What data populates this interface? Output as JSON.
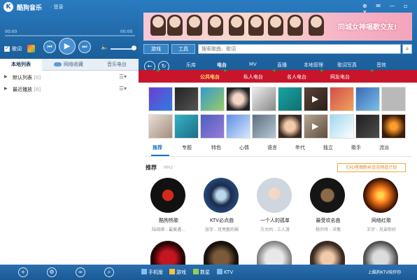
{
  "app": {
    "logo": "K",
    "name": "酷狗音乐",
    "login": "· 登录"
  },
  "player": {
    "time_current": "00:00",
    "time_total": "00:00",
    "lyric_label": "歌词",
    "prev_icon": "prev-icon",
    "play_icon": "play-icon",
    "next_icon": "next-icon",
    "volume_icon": "volume-icon"
  },
  "left_tabs": [
    "本地列表",
    "网络收藏",
    "音乐电台"
  ],
  "left_list": [
    {
      "label": "默认列表",
      "count": "[0]"
    },
    {
      "label": "最近播放",
      "count": "[0]"
    }
  ],
  "left_bottom": [
    "add-icon",
    "settings-icon",
    "loop-icon",
    "search-icon"
  ],
  "window": {
    "controls": "⊕ ✉ — ▫ ✕"
  },
  "banner": {
    "text": "同城女神唱歌交友!"
  },
  "toolbar": {
    "game_label": "游戏",
    "tool_label": "工具",
    "search_placeholder": "搜索歌曲、歌词"
  },
  "main_tabs": [
    "乐库",
    "电台",
    "MV",
    "直播",
    "本地管理",
    "歌词写真",
    "音效"
  ],
  "active_main_tab": "电台",
  "sub_tabs": [
    "公共电台",
    "私人电台",
    "名人电台",
    "网友电台"
  ],
  "category_tabs": [
    "推荐",
    "专题",
    "特色",
    "心情",
    "语言",
    "年代",
    "独立",
    "歌手",
    "流派"
  ],
  "recommend": {
    "title": "推荐",
    "subtitle": "MHz",
    "rank_button": "EXO星图粉丝交流频道计划"
  },
  "stations": [
    {
      "name": "酷狗热歌",
      "desc": "陆琦琪 - 最美遇..."
    },
    {
      "name": "KTV必点曲",
      "desc": "张宇 - 月亮惹的祸"
    },
    {
      "name": "一个人的孤单",
      "desc": "方大同 - 三人游"
    },
    {
      "name": "最受欢名曲",
      "desc": "杨宗纬 - 洋葱"
    },
    {
      "name": "网络红歌",
      "desc": "王宇 - 兄弟你好"
    }
  ],
  "bottom_bar": {
    "items": [
      "手机版",
      "游戏",
      "数星",
      "KTV"
    ],
    "status": "上酷狗KTV陪伴你"
  }
}
